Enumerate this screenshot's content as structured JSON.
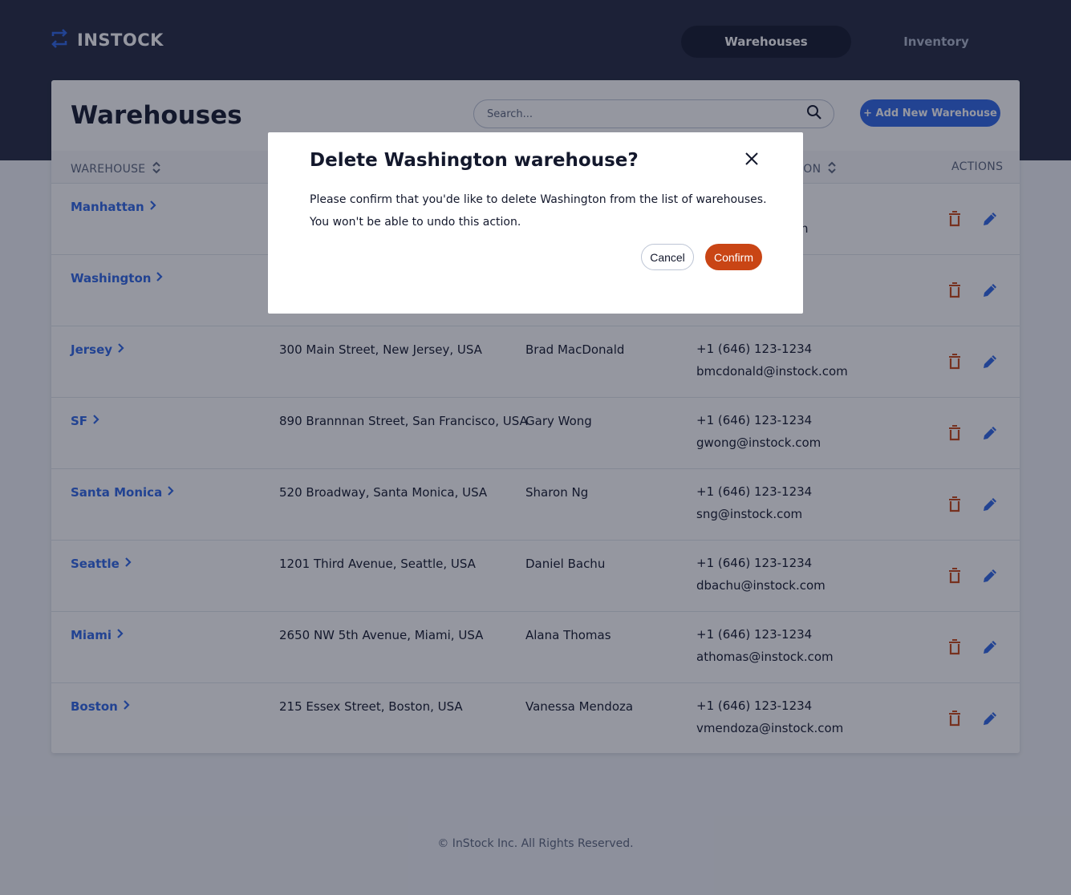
{
  "header": {
    "logo_text": "INSTOCK",
    "nav": [
      "Warehouses",
      "Inventory"
    ]
  },
  "page": {
    "title": "Warehouses",
    "search_placeholder": "Search...",
    "add_button": "+ Add New Warehouse",
    "columns": {
      "warehouse": "WAREHOUSE",
      "contact_info": "TION",
      "actions": "ACTIONS"
    }
  },
  "rows": [
    {
      "name": "Manhattan",
      "address": "",
      "contact": "",
      "phone": "",
      "email": "n"
    },
    {
      "name": "Washington",
      "address": "",
      "contact": "",
      "phone": "",
      "email": ""
    },
    {
      "name": "Jersey",
      "address": "300 Main Street, New Jersey, USA",
      "contact": "Brad MacDonald",
      "phone": "+1 (646) 123-1234",
      "email": "bmcdonald@instock.com"
    },
    {
      "name": "SF",
      "address": "890 Brannnan Street, San Francisco, USA",
      "contact": "Gary Wong",
      "phone": "+1 (646) 123-1234",
      "email": "gwong@instock.com"
    },
    {
      "name": "Santa Monica",
      "address": "520 Broadway, Santa Monica, USA",
      "contact": "Sharon Ng",
      "phone": "+1 (646) 123-1234",
      "email": "sng@instock.com"
    },
    {
      "name": "Seattle",
      "address": "1201 Third Avenue, Seattle, USA",
      "contact": "Daniel Bachu",
      "phone": "+1 (646) 123-1234",
      "email": "dbachu@instock.com"
    },
    {
      "name": "Miami",
      "address": "2650 NW 5th Avenue, Miami, USA",
      "contact": "Alana Thomas",
      "phone": "+1 (646) 123-1234",
      "email": "athomas@instock.com"
    },
    {
      "name": "Boston",
      "address": "215 Essex Street, Boston, USA",
      "contact": "Vanessa Mendoza",
      "phone": "+1 (646) 123-1234",
      "email": "vmendoza@instock.com"
    }
  ],
  "footer": "© InStock Inc. All Rights Reserved.",
  "modal": {
    "title": "Delete Washington warehouse?",
    "body_line1": "Please confirm that you'de like to delete Washington from the list of warehouses.",
    "body_line2": "You won't be able to undo this action.",
    "cancel": "Cancel",
    "confirm": "Confirm"
  },
  "colors": {
    "header": "#232940",
    "accent": "#2e66e6",
    "danger": "#c94515",
    "text": "#13182c"
  },
  "icons": {
    "logo": "swap-arrows-icon",
    "search": "search-icon",
    "sort": "sort-icon",
    "chevron": "chevron-right-icon",
    "delete": "trash-icon",
    "edit": "pencil-icon",
    "close": "close-icon"
  }
}
